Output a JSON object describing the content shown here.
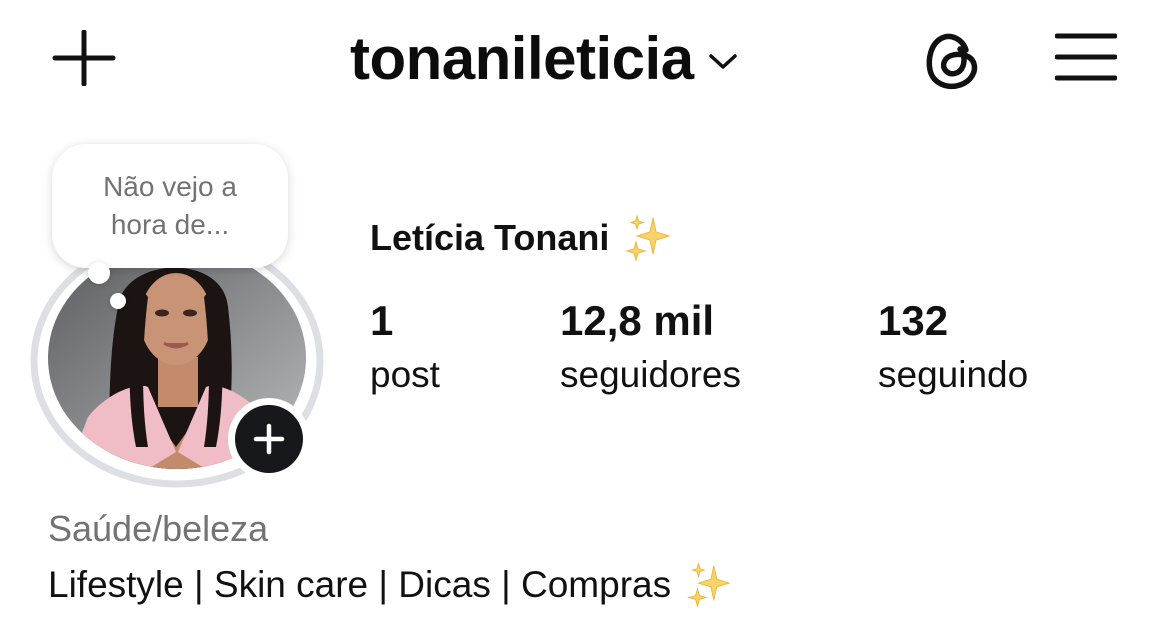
{
  "header": {
    "username": "tonanileticia",
    "icons": {
      "create": "plus-icon",
      "switch_account": "chevron-down-icon",
      "threads": "threads-icon",
      "menu": "hamburger-menu-icon"
    }
  },
  "profile": {
    "note": "Não vejo a\nhora de...",
    "display_name": "Letícia Tonani",
    "display_name_emoji": "sparkles-icon",
    "add_story_icon": "plus-icon",
    "stats": [
      {
        "value": "1",
        "label": "post"
      },
      {
        "value": "12,8 mil",
        "label": "seguidores"
      },
      {
        "value": "132",
        "label": "seguindo"
      }
    ],
    "category": "Saúde/beleza",
    "bio": "Lifestyle | Skin care | Dicas | Compras",
    "bio_emoji": "sparkles-icon"
  },
  "colors": {
    "text": "#0f0f0f",
    "secondary_text": "#737373",
    "ring": "#dcdfe3",
    "sparkle": "#f7d36a"
  }
}
